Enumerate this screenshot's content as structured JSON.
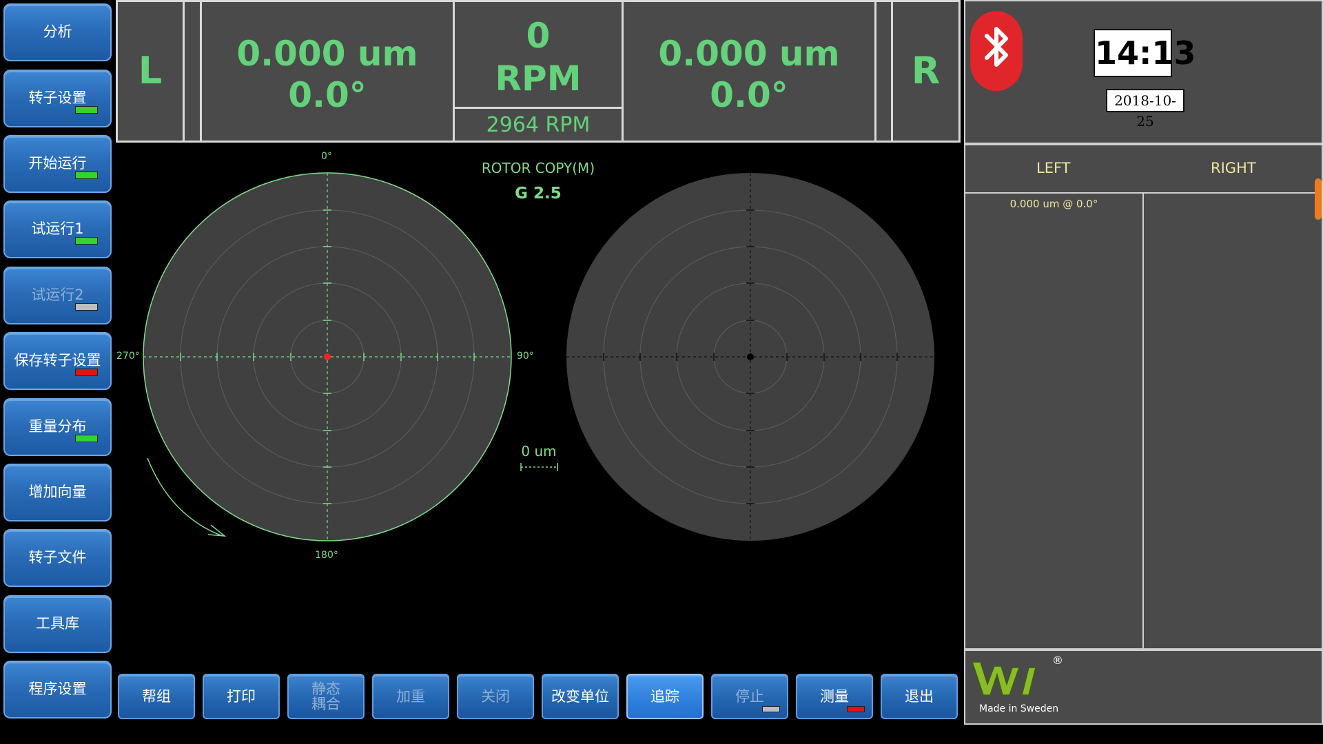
{
  "sidebar": {
    "items": [
      {
        "label": "分析",
        "indicator": null
      },
      {
        "label": "转子设置",
        "indicator": "green"
      },
      {
        "label": "开始运行",
        "indicator": "green"
      },
      {
        "label": "试运行1",
        "indicator": "green"
      },
      {
        "label": "试运行2",
        "indicator": "gray",
        "disabled": true
      },
      {
        "label": "保存转子设置",
        "indicator": "red"
      },
      {
        "label": "重量分布",
        "indicator": "green"
      },
      {
        "label": "增加向量",
        "indicator": null
      },
      {
        "label": "转子文件",
        "indicator": null
      },
      {
        "label": "工具库",
        "indicator": null
      },
      {
        "label": "程序设置",
        "indicator": null
      }
    ]
  },
  "readout": {
    "left_label": "L",
    "left_amp": "0.000 um",
    "left_angle": "0.0°",
    "rpm_value": "0",
    "rpm_unit": "RPM",
    "rpm_set": "2964 RPM",
    "right_amp": "0.000 um",
    "right_angle": "0.0°",
    "right_label": "R"
  },
  "plot": {
    "title": "ROTOR COPY(M)",
    "grade": "G 2.5",
    "angle_top": "0°",
    "angle_bottom": "180°",
    "angle_left": "270°",
    "angle_right": "90°",
    "scale_label": "0 um"
  },
  "toolbar": {
    "buttons": [
      {
        "label": "帮组"
      },
      {
        "label": "打印"
      },
      {
        "label": "静态\n耦合",
        "disabled": true
      },
      {
        "label": "加重",
        "disabled": true
      },
      {
        "label": "关闭",
        "disabled": true
      },
      {
        "label": "改变单位"
      },
      {
        "label": "追踪",
        "active": true
      },
      {
        "label": "停止",
        "disabled": true,
        "indicator": "gray"
      },
      {
        "label": "测量",
        "indicator": "red"
      },
      {
        "label": "退出"
      }
    ]
  },
  "status": {
    "time": "14:13",
    "date": "2018-10-25",
    "bluetooth_icon": "bluetooth-icon"
  },
  "results": {
    "left_header": "LEFT",
    "right_header": "RIGHT",
    "left_entry": "0.000 um @ 0.0°"
  },
  "brand": {
    "logo_text": "VMI",
    "tagline": "Made in Sweden",
    "registered": "®"
  },
  "colors": {
    "readout_green": "#63d27a",
    "plot_green": "#7fdc8a",
    "button_blue": "#2a6cb8",
    "indicator_green": "#33d42c",
    "indicator_red": "#e01414",
    "bluetooth_red": "#e0262a"
  }
}
